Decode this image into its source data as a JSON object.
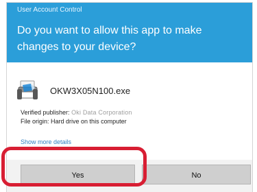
{
  "dialog": {
    "window_title": "User Account Control",
    "question": "Do you want to allow this app to make changes to your device?",
    "app_name": "OKW3X05N100.exe",
    "publisher_label": "Verified publisher:",
    "publisher_value": "Oki Data Corporation",
    "origin_label": "File origin:",
    "origin_value": "Hard drive on this computer",
    "details_link": "Show more details",
    "yes_label": "Yes",
    "no_label": "No"
  },
  "icons": {
    "app": "printer-setup-icon"
  },
  "colors": {
    "header": "#2b9ed9",
    "button_row": "#f2f2f2",
    "button": "#cfcfcf",
    "highlight": "#d81e33",
    "link": "#2f7fc1"
  }
}
